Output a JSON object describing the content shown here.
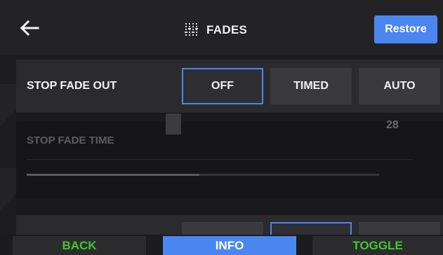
{
  "header": {
    "back_icon": "back-arrow-icon",
    "title_icon": "sliders-icon",
    "title": "FADES",
    "restore_label": "Restore",
    "accent": "#4a86f0"
  },
  "stop_fade_out": {
    "label": "STOP FADE OUT",
    "options": [
      "OFF",
      "TIMED",
      "AUTO"
    ],
    "selected": "OFF"
  },
  "stop_fade_time": {
    "label": "STOP FADE TIME",
    "value": "28",
    "fill_percent": 49
  },
  "bottom_bar": {
    "back_label": "BACK",
    "info_label": "INFO",
    "toggle_label": "TOGGLE",
    "green": "#3ec92b"
  }
}
